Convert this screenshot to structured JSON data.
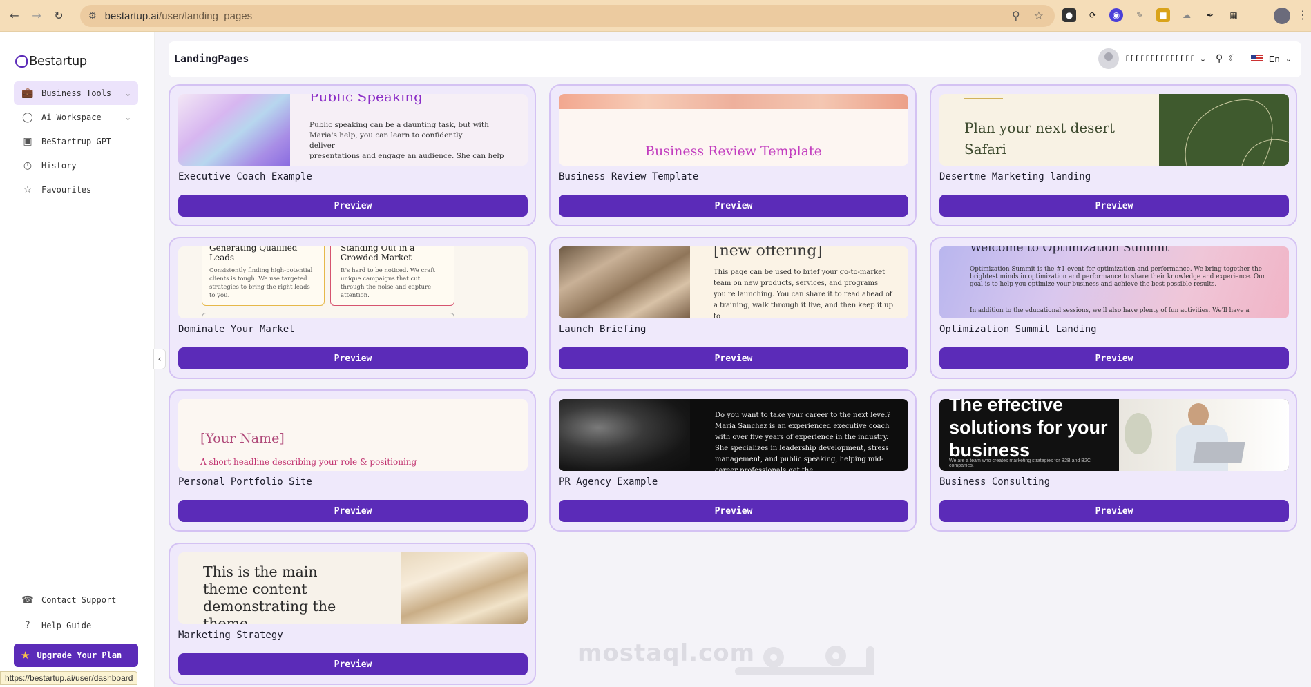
{
  "browser": {
    "url_host": "bestartup.ai",
    "url_path": "/user/landing_pages",
    "status_url": "https://bestartup.ai/user/dashboard"
  },
  "sidebar": {
    "logo": "Bestartup",
    "items": [
      {
        "label": "Business Tools",
        "icon": "briefcase-icon"
      },
      {
        "label": "Ai Workspace",
        "icon": "lightbulb-icon"
      },
      {
        "label": "BeStartrup GPT",
        "icon": "robot-icon"
      },
      {
        "label": "History",
        "icon": "clock-icon"
      },
      {
        "label": "Favourites",
        "icon": "star-icon"
      }
    ],
    "contact_support": "Contact Support",
    "help_guide": "Help Guide",
    "upgrade": "Upgrade Your Plan"
  },
  "header": {
    "title": "LandingPages",
    "username": "ffffffffffffff",
    "language": "En"
  },
  "cards": [
    {
      "title": "Executive Coach Example",
      "button": "Preview",
      "thumb": {
        "heading": "Public Speaking",
        "l1": "Public speaking can be a daunting task, but with",
        "l2": "Maria's help, you can learn to confidently",
        "l3": "deliver",
        "l4": "presentations and engage an audience. She can help"
      }
    },
    {
      "title": "Business Review Template",
      "button": "Preview",
      "thumb": {
        "heading": "Business Review Template"
      }
    },
    {
      "title": "Desertme Marketing landing",
      "button": "Preview",
      "thumb": {
        "heading": "Plan your next desert Safari"
      }
    },
    {
      "title": "Dominate Your Market",
      "button": "Preview",
      "thumb": {
        "h1": "Generating Qualified Leads",
        "p1": "Consistently finding high-potential clients is tough. We use targeted strategies to bring the right leads to you.",
        "h2": "Standing Out in a Crowded Market",
        "p2": "It's hard to be noticed. We craft unique campaigns that cut through the noise and capture attention."
      }
    },
    {
      "title": "Launch Briefing",
      "button": "Preview",
      "thumb": {
        "heading": "[new offering]",
        "body": "This page can be used to brief your go-to-market team on new products, services, and programs you're launching. You can share it to read ahead of a training, walk through it live, and then keep it up to"
      }
    },
    {
      "title": "Optimization Summit Landing",
      "button": "Preview",
      "thumb": {
        "heading": "Welcome to Optimization Summit",
        "body": "Optimization Summit is the #1 event for optimization and performance. We bring together the brightest minds in optimization and performance to share their knowledge and experience. Our goal is to help you optimize your business and achieve the best possible results.",
        "body2": "In addition to the educational sessions, we'll also have plenty of fun activities. We'll have a"
      }
    },
    {
      "title": "Personal Portfolio Site",
      "button": "Preview",
      "thumb": {
        "heading": "[Your Name]",
        "sub": "A short headline describing your role & positioning"
      }
    },
    {
      "title": "PR Agency Example",
      "button": "Preview",
      "thumb": {
        "body": "Do you want to take your career to the next level? Maria Sanchez is an experienced executive coach with over five years of experience in the industry. She specializes in leadership development, stress management, and public speaking, helping mid-career professionals get the"
      }
    },
    {
      "title": "Business Consulting",
      "button": "Preview",
      "thumb": {
        "heading": "The effective solutions for your business",
        "small": "We are a team who creates marketing strategies for B2B and B2C companies."
      }
    },
    {
      "title": "Marketing Strategy",
      "button": "Preview",
      "thumb": {
        "heading": "This is the main theme content demonstrating the theme"
      }
    }
  ],
  "watermark": "mostaql.com",
  "colors": {
    "accent": "#5b2bb8",
    "card_bg": "#efe9fb",
    "card_border": "#d4c2f3",
    "chrome": "#f5ddb8"
  }
}
